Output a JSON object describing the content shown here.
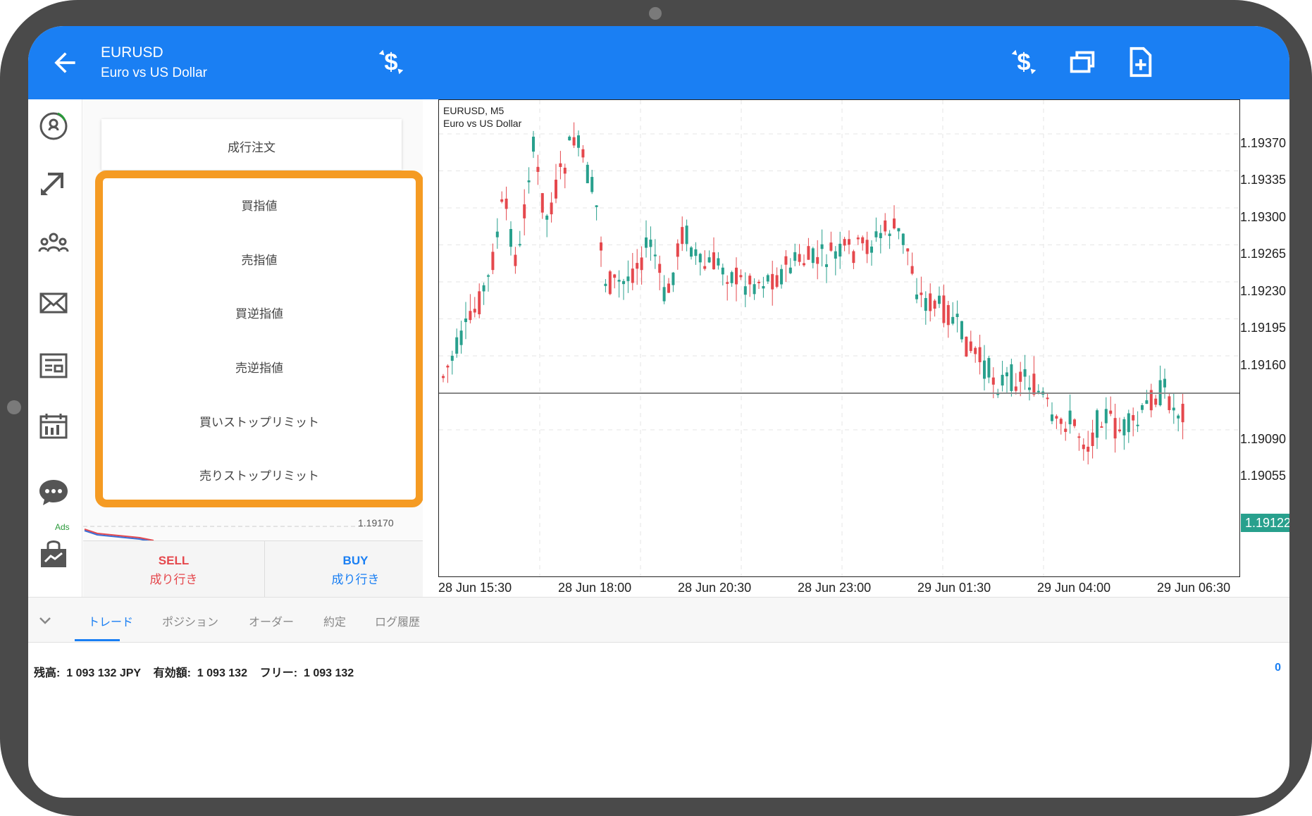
{
  "header": {
    "symbol": "EURUSD",
    "description": "Euro vs US Dollar"
  },
  "order_menu": {
    "market": "成行注文",
    "items": [
      "買指値",
      "売指値",
      "買逆指値",
      "売逆指値",
      "買いストップリミット",
      "売りストップリミット"
    ]
  },
  "mini_chart": {
    "price": "1.19170"
  },
  "trade_buttons": {
    "sell_label": "SELL",
    "sell_sub": "成り行き",
    "buy_label": "BUY",
    "buy_sub": "成り行き"
  },
  "chart": {
    "caption_line1": "EURUSD, M5",
    "caption_line2": "Euro vs US Dollar",
    "current_price": "1.19122",
    "y_ticks": [
      "1.19370",
      "1.19335",
      "1.19300",
      "1.19265",
      "1.19230",
      "1.19195",
      "1.19160",
      "1.19090",
      "1.19055"
    ],
    "x_ticks": [
      "28 Jun 15:30",
      "28 Jun 18:00",
      "28 Jun 20:30",
      "28 Jun 23:00",
      "29 Jun 01:30",
      "29 Jun 04:00",
      "29 Jun 06:30"
    ],
    "colors": {
      "bull": "#28a08d",
      "bear": "#e5484d",
      "line": "#888888"
    }
  },
  "bottom_tabs": [
    "トレード",
    "ポジション",
    "オーダー",
    "約定",
    "ログ履歴"
  ],
  "account": {
    "balance_text": "残高:  1 093 132 JPY    有効額:  1 093 132    フリー:  1 093 132",
    "right_value": "0"
  },
  "ads_label": "Ads"
}
